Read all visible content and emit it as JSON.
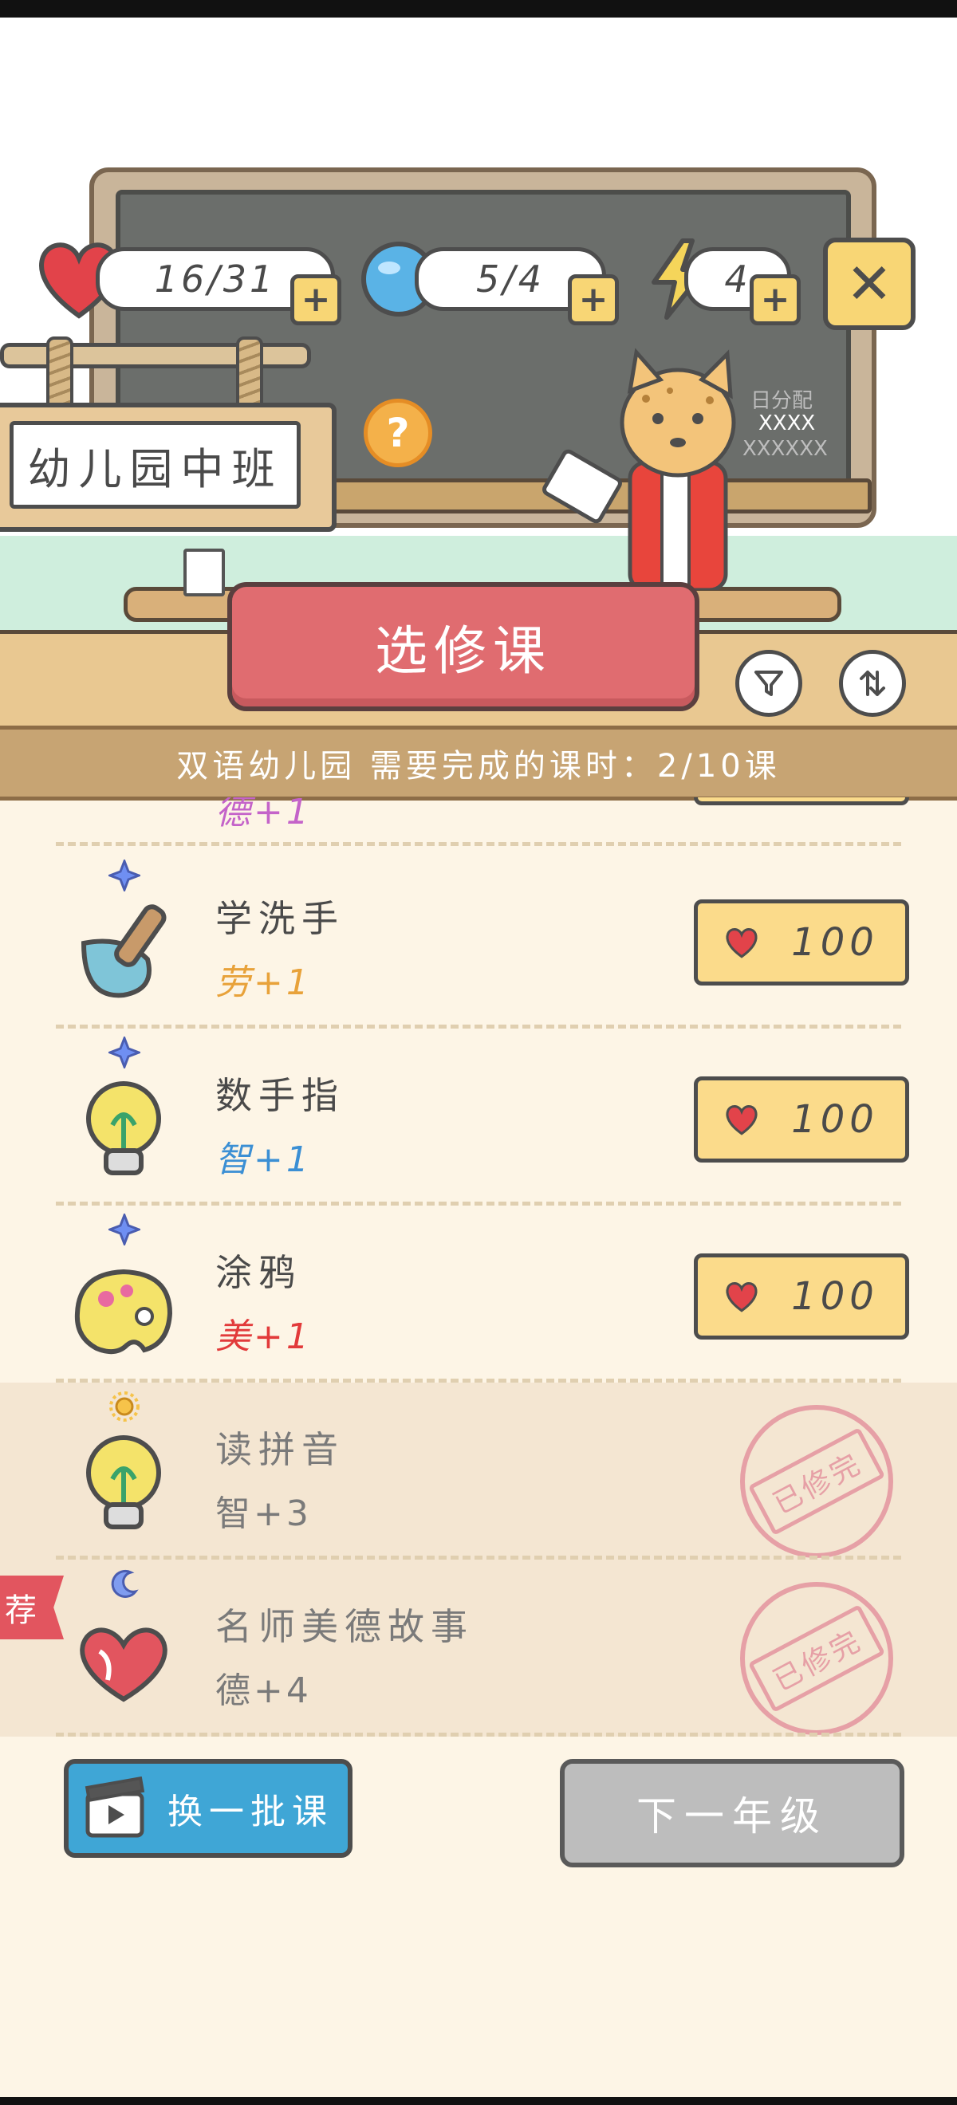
{
  "hud": {
    "health": "16/31",
    "gems": "5/4",
    "energy": "4",
    "plus": "+",
    "close": "✕"
  },
  "grade": {
    "label": "幼儿园中班",
    "help": "?"
  },
  "chalkboard": {
    "line1": "日分配",
    "line2": "XXXX",
    "line3": "XXXXXX"
  },
  "panel": {
    "title": "选修课",
    "requirement": "双语幼儿园 需要完成的课时：2/10课"
  },
  "courses": [
    {
      "name": "学洗手",
      "attr": "劳+1",
      "attr_color": "#e8a23a",
      "cost": "100",
      "status": "available",
      "icon": "shovel-icon",
      "badge": "blue-star-icon"
    },
    {
      "name": "数手指",
      "attr": "智+1",
      "attr_color": "#3b8fd4",
      "cost": "100",
      "status": "available",
      "icon": "lightbulb-icon",
      "badge": "blue-star-icon"
    },
    {
      "name": "涂鸦",
      "attr": "美+1",
      "attr_color": "#e23a3a",
      "cost": "100",
      "status": "available",
      "icon": "palette-icon",
      "badge": "blue-star-icon"
    },
    {
      "name": "读拼音",
      "attr": "智+3",
      "attr_color": "#7a7a7a",
      "status_label": "已修完",
      "status": "completed",
      "icon": "lightbulb-icon",
      "badge": "sun-icon"
    },
    {
      "name": "名师美德故事",
      "attr": "德+4",
      "attr_color": "#7a7a7a",
      "status_label": "已修完",
      "status": "completed",
      "icon": "heart-hands-icon",
      "badge": "moon-icon",
      "tag": "荐"
    }
  ],
  "partial_row_attr": "德+1",
  "buttons": {
    "refresh": "换一批课",
    "next_grade": "下一年级"
  },
  "colors": {
    "accent_red": "#e06c70",
    "accent_yellow": "#fbdb8b",
    "blue": "#3fa6d6"
  }
}
